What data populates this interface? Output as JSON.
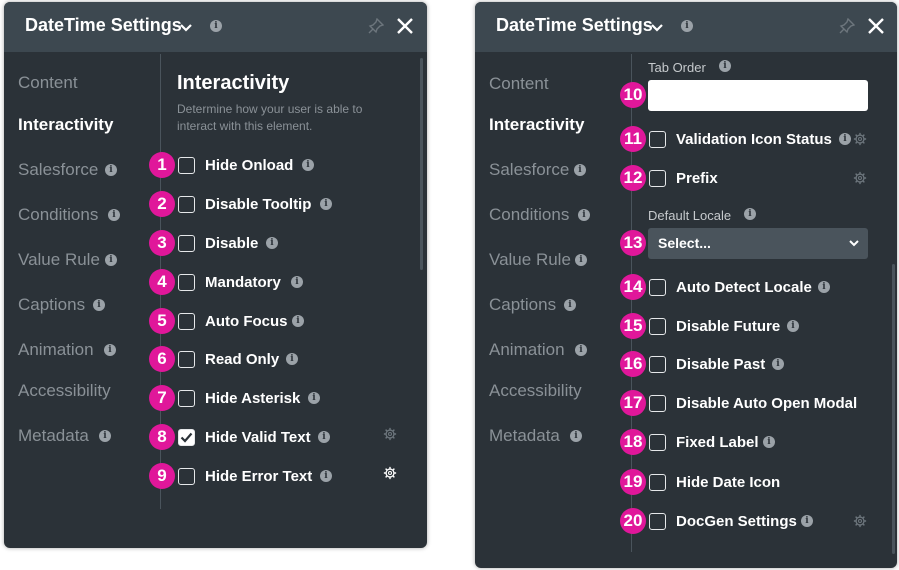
{
  "panel_title": "DateTime Settings",
  "nav": {
    "content": "Content",
    "interactivity": "Interactivity",
    "salesforce": "Salesforce",
    "conditions": "Conditions",
    "value_rule": "Value Rule",
    "captions": "Captions",
    "animation": "Animation",
    "accessibility": "Accessibility",
    "metadata": "Metadata"
  },
  "section": {
    "title": "Interactivity",
    "description": "Determine how your user is able to interact with this element."
  },
  "left_options": [
    {
      "num": "1",
      "label": "Hide Onload",
      "checked": false
    },
    {
      "num": "2",
      "label": "Disable Tooltip",
      "checked": false
    },
    {
      "num": "3",
      "label": "Disable",
      "checked": false
    },
    {
      "num": "4",
      "label": "Mandatory",
      "checked": false
    },
    {
      "num": "5",
      "label": "Auto Focus",
      "checked": false
    },
    {
      "num": "6",
      "label": "Read Only",
      "checked": false
    },
    {
      "num": "7",
      "label": "Hide Asterisk",
      "checked": false
    },
    {
      "num": "8",
      "label": "Hide Valid Text",
      "checked": true
    },
    {
      "num": "9",
      "label": "Hide Error Text",
      "checked": false
    }
  ],
  "right": {
    "tab_order_label": "Tab Order",
    "tab_order_value": "",
    "default_locale_label": "Default Locale",
    "select_value": "Select...",
    "badges": [
      "10",
      "11",
      "12",
      "13",
      "14",
      "15",
      "16",
      "17",
      "18",
      "19",
      "20"
    ],
    "options": [
      {
        "label": "Validation Icon Status",
        "checked": false
      },
      {
        "label": "Prefix",
        "checked": false
      },
      {
        "label": "Auto Detect Locale",
        "checked": false
      },
      {
        "label": "Disable Future",
        "checked": false
      },
      {
        "label": "Disable Past",
        "checked": false
      },
      {
        "label": "Disable Auto Open Modal",
        "checked": false
      },
      {
        "label": "Fixed Label",
        "checked": false
      },
      {
        "label": "Hide Date Icon",
        "checked": false
      },
      {
        "label": "DocGen Settings",
        "checked": false
      }
    ]
  },
  "icons": {
    "info": "i",
    "badge_color": "#e0179a",
    "header_color": "#3d4850",
    "panel_color": "#2b3238"
  }
}
